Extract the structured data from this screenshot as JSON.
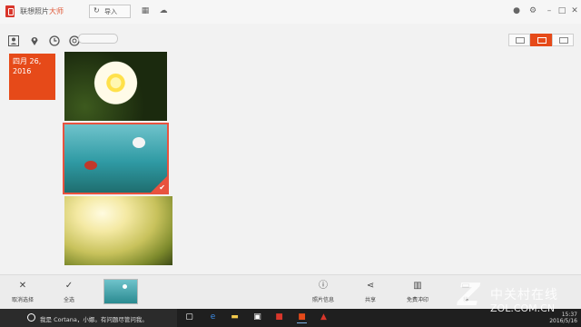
{
  "titlebar": {
    "app_name": "联想照片",
    "app_name_accent": "大师",
    "import_label": "导入",
    "icons": [
      "calendar-icon",
      "cloud-icon",
      "chat-icon",
      "settings-icon",
      "minimize-icon",
      "maximize-icon",
      "close-icon"
    ]
  },
  "filters": {
    "icons": [
      "person-icon",
      "location-icon",
      "clock-icon",
      "search-icon"
    ],
    "view_modes": [
      "list-view",
      "grid-view",
      "folder-view"
    ],
    "active_view": "grid-view"
  },
  "date_group": {
    "line1": "四月 26,",
    "line2": "2016"
  },
  "photos": [
    {
      "subject": "yellow-white-flower",
      "selected": false
    },
    {
      "subject": "ladybug-dandelion",
      "selected": true
    },
    {
      "subject": "sunlit-grass",
      "selected": false
    }
  ],
  "actions_left": [
    {
      "icon": "close-icon",
      "label": "取消选择"
    },
    {
      "icon": "check-icon",
      "label": "全选"
    }
  ],
  "actions_right": [
    {
      "icon": "info-icon",
      "label": "照片信息"
    },
    {
      "icon": "share-icon",
      "label": "共享"
    },
    {
      "icon": "gift-icon",
      "label": "免费冲印"
    },
    {
      "icon": "folder-icon",
      "label": "移"
    }
  ],
  "taskbar": {
    "cortana_text": "我是 Cortana，小娜。有问题尽管问我。",
    "time": "15:37",
    "date": "2016/5/16"
  },
  "watermark": {
    "cn": "中关村在线",
    "en": "ZOL.COM.CN"
  },
  "colors": {
    "accent": "#e64a19",
    "selection": "#e8533f"
  }
}
